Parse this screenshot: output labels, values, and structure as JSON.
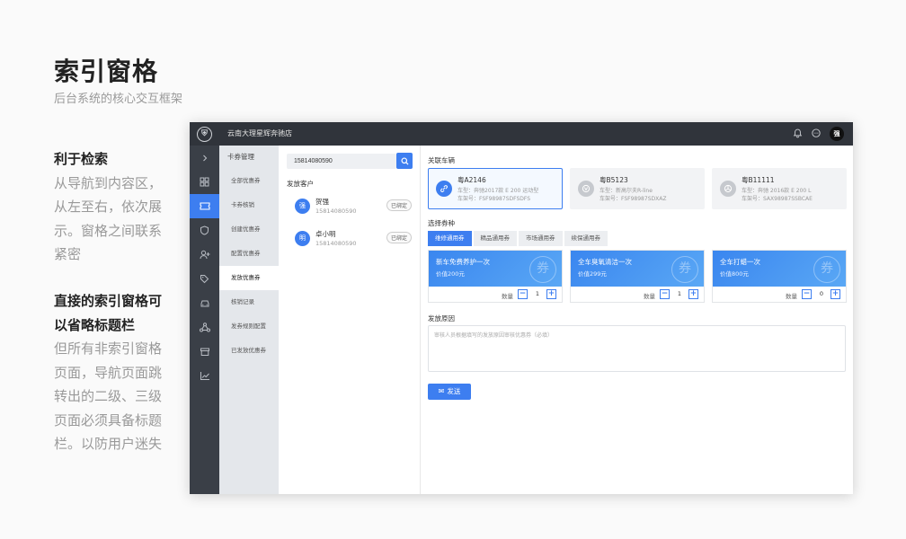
{
  "page": {
    "title": "索引窗格",
    "subtitle": "后台系统的核心交互框架"
  },
  "desc1": {
    "heading": "利于检索",
    "body": "从导航到内容区，从左至右，依次展示。窗格之间联系紧密"
  },
  "desc2": {
    "heading": "直接的索引窗格可以省略标题栏",
    "body": "但所有非索引窗格页面，导航页面跳转出的二级、三级页面必须具备标题栏。以防用户迷失"
  },
  "app": {
    "logo_char": "⛨",
    "store_name": "云南大理星辉奔驰店",
    "icons": {
      "bell": "bell-icon",
      "chat": "chat-icon"
    },
    "user_avatar": "强",
    "rail_icons": [
      "chevron-right-icon",
      "grid-icon",
      "ticket-icon",
      "shield-icon",
      "user-add-icon",
      "tag-icon",
      "car-icon",
      "network-icon",
      "store-icon",
      "chart-icon"
    ],
    "submenu": {
      "header": "卡券管理",
      "items": [
        "全部优惠券",
        "卡券核销",
        "创建优惠券",
        "配置优惠券",
        "发放优惠券",
        "核销记录",
        "发券规则配置",
        "已发放优惠券"
      ],
      "active_index": 4
    },
    "customers": {
      "search_value": "15814080590",
      "title": "发放客户",
      "list": [
        {
          "avatar": "强",
          "name": "贺强",
          "phone": "15814080590",
          "tag": "已绑定"
        },
        {
          "avatar": "明",
          "name": "卓小明",
          "phone": "15814080590",
          "tag": "已绑定"
        }
      ]
    },
    "cars": {
      "label": "关联车辆",
      "list": [
        {
          "plate": "粤A2146",
          "model": "车型：奔驰2017款 E 200 运动型",
          "vin": "车架号：FSF98987SDFSDFS"
        },
        {
          "plate": "粤B5123",
          "model": "车型：新高尔夫R-line",
          "vin": "车架号：FSF98987SDXAZ"
        },
        {
          "plate": "粤B11111",
          "model": "车型：奔驰 2016款 E 200 L",
          "vin": "车架号：SAX98987SSBCAE"
        }
      ]
    },
    "coupons": {
      "label": "选择券种",
      "tabs": [
        "维修通用券",
        "精品通用券",
        "市场通用券",
        "续保通用券"
      ],
      "active_tab": 0,
      "qty_label": "数量",
      "stamp": "券",
      "list": [
        {
          "name": "新车免费养护一次",
          "price": "价值200元",
          "qty": "1"
        },
        {
          "name": "全车臭氧清洁一次",
          "price": "价值299元",
          "qty": "1"
        },
        {
          "name": "全车打蜡一次",
          "price": "价值800元",
          "qty": "0"
        }
      ]
    },
    "reason": {
      "label": "发放原因",
      "placeholder": "审核人员根据填写的发放原因审核优惠券（必填）"
    },
    "send_label": "发送"
  }
}
